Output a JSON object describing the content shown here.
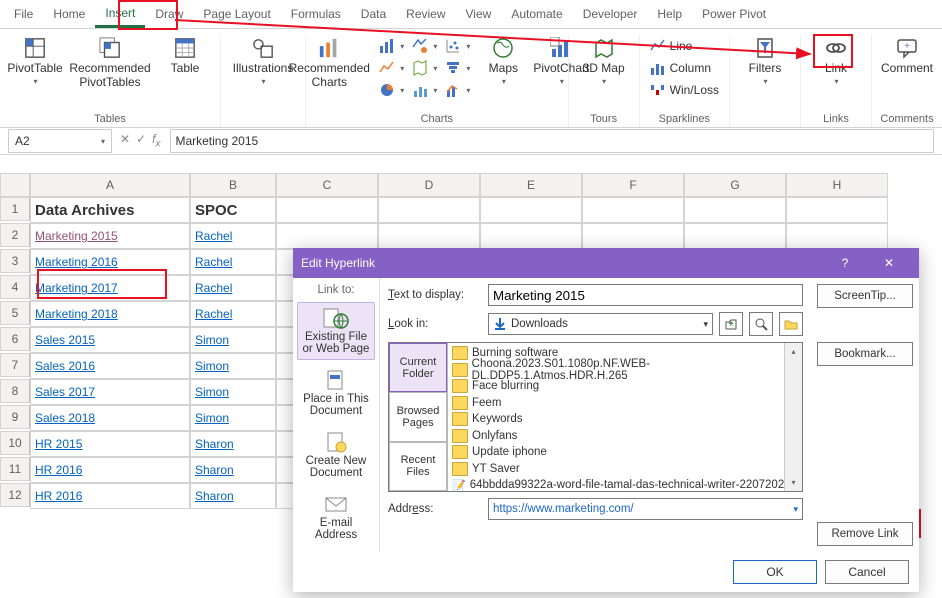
{
  "ribbon_tabs": [
    "File",
    "Home",
    "Insert",
    "Draw",
    "Page Layout",
    "Formulas",
    "Data",
    "Review",
    "View",
    "Automate",
    "Developer",
    "Help",
    "Power Pivot"
  ],
  "selected_tab": "Insert",
  "ribbon": {
    "pivot": "PivotTable",
    "rec_pivot": "Recommended PivotTables",
    "table": "Table",
    "illus": "Illustrations",
    "rec_chart": "Recommended Charts",
    "maps": "Maps",
    "pivotchart": "PivotChart",
    "map3d": "3D Map",
    "spark_line": "Line",
    "spark_col": "Column",
    "spark_wl": "Win/Loss",
    "filters": "Filters",
    "link": "Link",
    "comment": "Comment",
    "grp_tables": "Tables",
    "grp_charts": "Charts",
    "grp_tours": "Tours",
    "grp_spark": "Sparklines",
    "grp_links": "Links",
    "grp_comments": "Comments"
  },
  "namebox": "A2",
  "formula": "Marketing 2015",
  "cols": [
    "A",
    "B",
    "C",
    "D",
    "E",
    "F",
    "G",
    "H"
  ],
  "header": {
    "a": "Data Archives",
    "b": "SPOC"
  },
  "rows": [
    {
      "n": "1",
      "a": "Data Archives",
      "b": "SPOC",
      "hdr": true
    },
    {
      "n": "2",
      "a": "Marketing 2015",
      "b": "Rachel",
      "visited": true
    },
    {
      "n": "3",
      "a": "Marketing 2016",
      "b": "Rachel"
    },
    {
      "n": "4",
      "a": "Marketing 2017",
      "b": "Rachel"
    },
    {
      "n": "5",
      "a": "Marketing 2018",
      "b": "Rachel"
    },
    {
      "n": "6",
      "a": "Sales 2015",
      "b": "Simon"
    },
    {
      "n": "7",
      "a": "Sales 2016",
      "b": "Simon"
    },
    {
      "n": "8",
      "a": "Sales 2017",
      "b": "Simon"
    },
    {
      "n": "9",
      "a": "Sales 2018",
      "b": "Simon"
    },
    {
      "n": "10",
      "a": "HR 2015",
      "b": "Sharon"
    },
    {
      "n": "11",
      "a": "HR 2016",
      "b": "Sharon"
    },
    {
      "n": "12",
      "a": "HR 2016",
      "b": "Sharon"
    }
  ],
  "dialog": {
    "title": "Edit Hyperlink",
    "link_to": "Link to:",
    "cards": {
      "web": "Existing File or Web Page",
      "place": "Place in This Document",
      "new": "Create New Document",
      "mail": "E-mail Address"
    },
    "text_to_display_label": "Text to display:",
    "text_to_display": "Marketing 2015",
    "lookin_label": "Look in:",
    "lookin": "Downloads",
    "browse_tabs": {
      "cur": "Current Folder",
      "brw": "Browsed Pages",
      "rec": "Recent Files"
    },
    "files": [
      "Burning software",
      "Choona.2023.S01.1080p.NF.WEB-DL.DDP5.1.Atmos.HDR.H.265",
      "Face blurring",
      "Feem",
      "Keywords",
      "Onlyfans",
      "Update iphone",
      "YT Saver",
      "64bbdda99322a-word-file-tamal-das-technical-writer-2207202"
    ],
    "address_label": "Address:",
    "address": "https://www.marketing.com/",
    "screentip": "ScreenTip...",
    "bookmark": "Bookmark...",
    "remove": "Remove Link",
    "ok": "OK",
    "cancel": "Cancel"
  }
}
